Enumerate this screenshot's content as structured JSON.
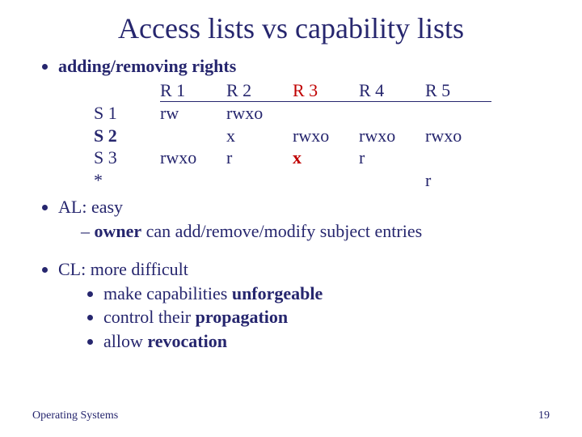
{
  "title": "Access lists vs capability lists",
  "bullet1_lead": "adding/removing ",
  "bullet1_strong": "rights",
  "matrix": {
    "headers": {
      "c1": "R 1",
      "c2": "R 2",
      "c3": "R 3",
      "c4": "R 4",
      "c5": "R 5"
    },
    "rows": {
      "s1": {
        "label": "S 1",
        "c1": "rw",
        "c2": "rwxo",
        "c3": "",
        "c4": "",
        "c5": ""
      },
      "s2": {
        "label": "S 2",
        "c1": "",
        "c2": "x",
        "c3": "rwxo",
        "c4": "rwxo",
        "c5": "rwxo"
      },
      "s3": {
        "label": "S 3",
        "c1": "rwxo",
        "c2": "r",
        "c3": "x",
        "c4": "r",
        "c5": ""
      },
      "st": {
        "label": "*",
        "c1": "",
        "c2": "",
        "c3": "",
        "c4": "",
        "c5": "r"
      }
    }
  },
  "al_line": "AL: easy",
  "al_sub_lead": "owner",
  "al_sub_rest": " can add/remove/modify subject entries",
  "cl_line": "CL: more difficult",
  "cl_sub1_a": "make capabilities ",
  "cl_sub1_b": "unforgeable",
  "cl_sub2_a": "control their ",
  "cl_sub2_b": "propagation",
  "cl_sub3_a": "allow ",
  "cl_sub3_b": "revocation",
  "footer_left": "Operating Systems",
  "footer_right": "19"
}
